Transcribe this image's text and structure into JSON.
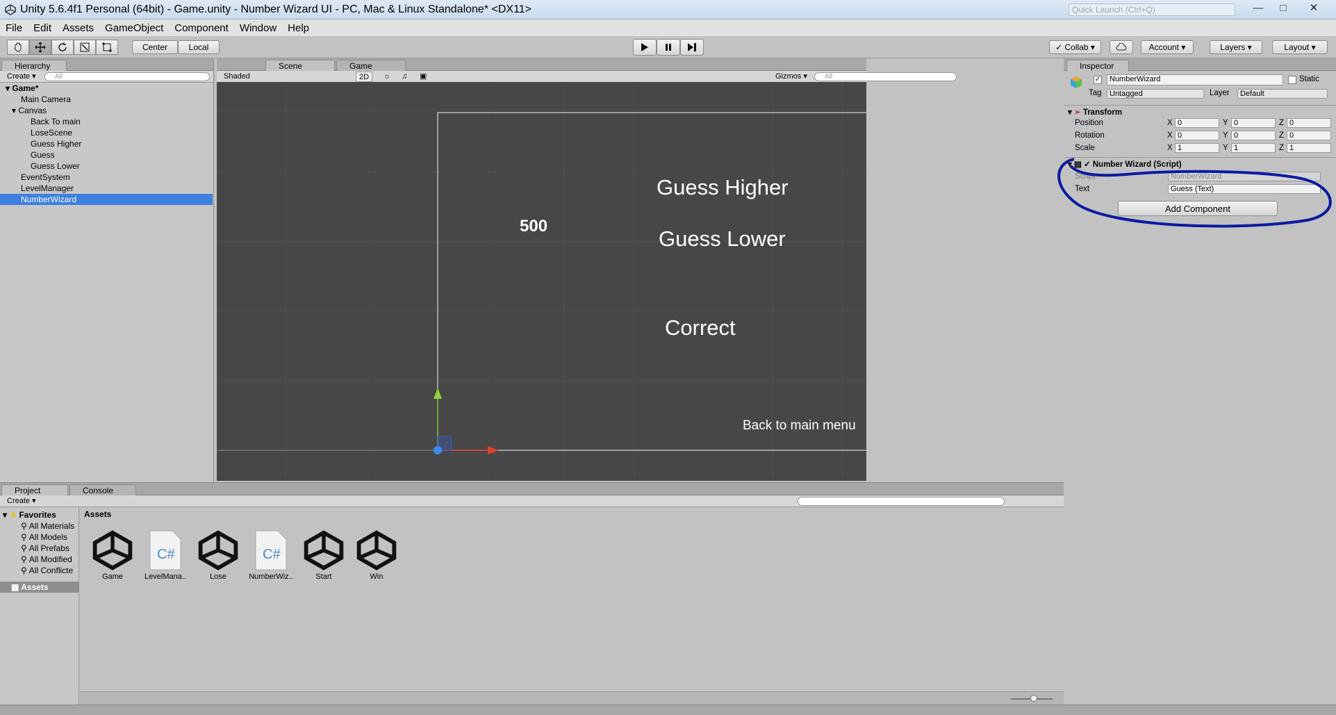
{
  "window": {
    "title": "Unity 5.6.4f1 Personal (64bit) - Game.unity - Number Wizard UI - PC, Mac & Linux Standalone* <DX11>",
    "quick_launch": "Quick Launch (Ctrl+Q)"
  },
  "menu": [
    "File",
    "Edit",
    "Assets",
    "GameObject",
    "Component",
    "Window",
    "Help"
  ],
  "toolbar": {
    "center": "Center",
    "local": "Local",
    "collab": "Collab",
    "account": "Account",
    "layers": "Layers",
    "layout": "Layout"
  },
  "hierarchy": {
    "tab": "Hierarchy",
    "create": "Create",
    "search_placeholder": "All",
    "items": [
      "Game*",
      "Main Camera",
      "Canvas",
      "Back To main",
      "LoseScene",
      "Guess Higher",
      "Guess",
      "Guess Lower",
      "EventSystem",
      "LevelManager",
      "NumberWizard"
    ]
  },
  "scene": {
    "tabs": [
      "Scene",
      "Game"
    ],
    "shading": "Shaded",
    "mode": "2D",
    "gizmos": "Gizmos",
    "search_placeholder": "All",
    "texts": {
      "guess_higher": "Guess Higher",
      "number": "500",
      "guess_lower": "Guess Lower",
      "correct": "Correct",
      "back": "Back to main menu"
    }
  },
  "inspector": {
    "tab": "Inspector",
    "object_name": "NumberWizard",
    "static": "Static",
    "tag_label": "Tag",
    "tag_value": "Untagged",
    "layer_label": "Layer",
    "layer_value": "Default",
    "transform": {
      "title": "Transform",
      "position_label": "Position",
      "rotation_label": "Rotation",
      "scale_label": "Scale",
      "position": [
        "0",
        "0",
        "0"
      ],
      "rotation": [
        "0",
        "0",
        "0"
      ],
      "scale": [
        "1",
        "1",
        "1"
      ],
      "axes": [
        "X",
        "Y",
        "Z"
      ]
    },
    "script": {
      "title": "Number Wizard (Script)",
      "script_label": "Script",
      "script_value": "NumberWizard",
      "text_label": "Text",
      "text_value": "Guess (Text)"
    },
    "add_component": "Add Component"
  },
  "project": {
    "tabs": [
      "Project",
      "Console"
    ],
    "create": "Create",
    "favorites_label": "Favorites",
    "favorites": [
      "All Materials",
      "All Models",
      "All Prefabs",
      "All Modified",
      "All Conflicte"
    ],
    "assets_folder": "Assets",
    "breadcrumb": "Assets",
    "assets": [
      {
        "name": "Game",
        "kind": "unity"
      },
      {
        "name": "LevelMana..",
        "kind": "cs"
      },
      {
        "name": "Lose",
        "kind": "unity"
      },
      {
        "name": "NumberWiz..",
        "kind": "cs"
      },
      {
        "name": "Start",
        "kind": "unity"
      },
      {
        "name": "Win",
        "kind": "unity"
      }
    ]
  },
  "colors": {
    "selection": "#3d80df",
    "scene_bg": "#474747",
    "annotation": "#0a1aa0"
  }
}
